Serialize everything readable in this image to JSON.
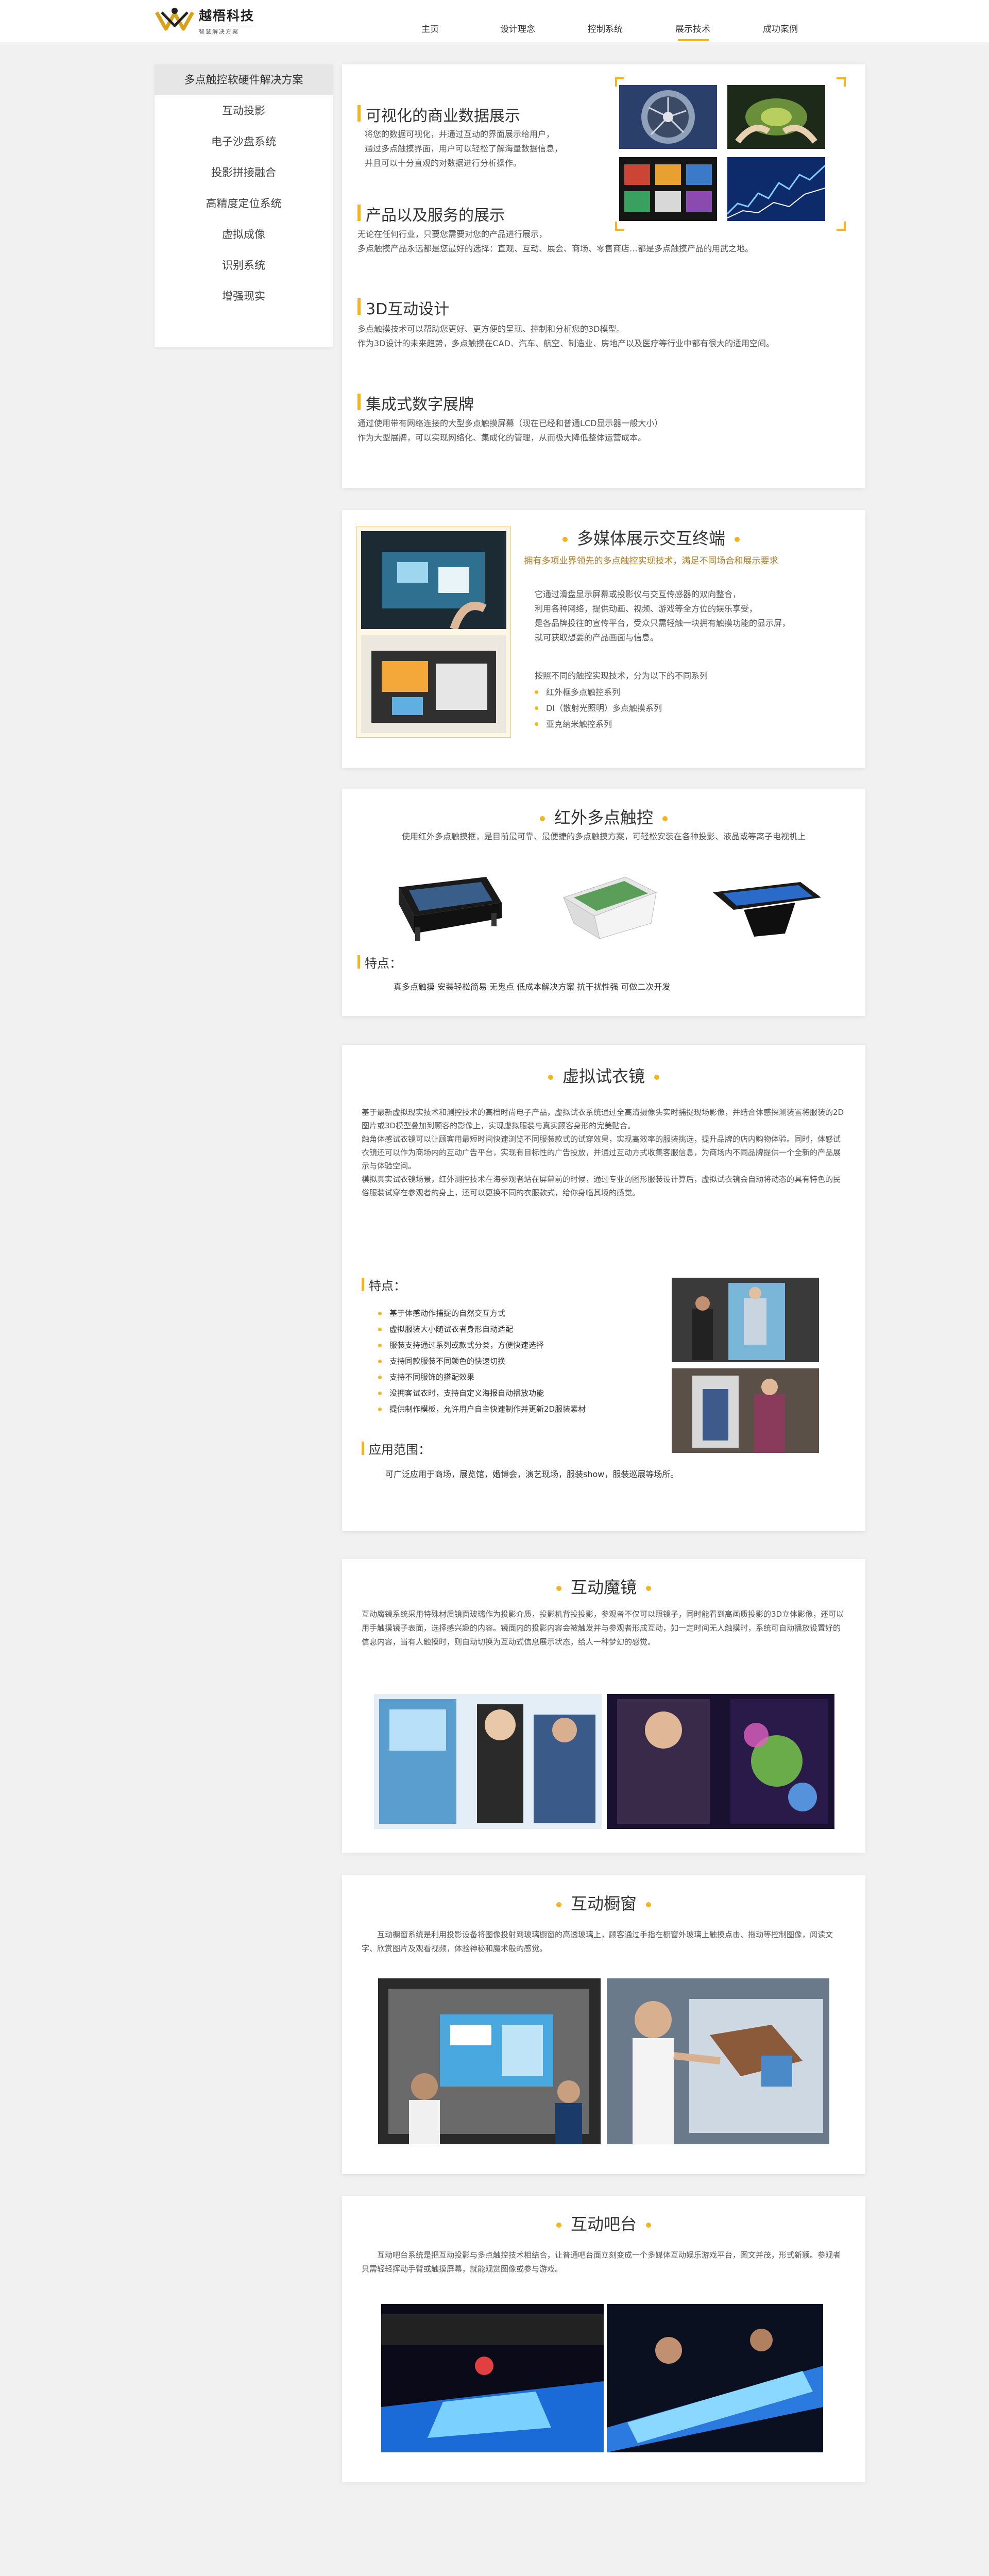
{
  "brand": {
    "name": "越梧科技",
    "tagline": "智慧解决方案"
  },
  "nav": [
    {
      "label": "主页",
      "active": false
    },
    {
      "label": "设计理念",
      "active": false
    },
    {
      "label": "控制系统",
      "active": false
    },
    {
      "label": "展示技术",
      "active": true
    },
    {
      "label": "成功案例",
      "active": false
    }
  ],
  "sidebar": {
    "header": "多点触控软硬件解决方案",
    "items": [
      "互动投影",
      "电子沙盘系统",
      "投影拼接融合",
      "高精度定位系统",
      "虚拟成像",
      "识别系统",
      "增强现实"
    ]
  },
  "intro": {
    "sections": [
      {
        "title": "可视化的商业数据展示",
        "lines": [
          "将您的数据可视化，并通过互动的界面展示给用户，",
          "通过多点触摸界面，用户可以轻松了解海量数据信息，",
          "并且可以十分直观的对数据进行分析操作。"
        ]
      },
      {
        "title": "产品以及服务的展示",
        "lines": [
          "无论在任何行业，只要您需要对您的产品进行展示，",
          "多点触摸产品永远都是您最好的选择：直观、互动、展会、商场、零售商店…都是多点触摸产品的用武之地。"
        ]
      },
      {
        "title": "3D互动设计",
        "lines": [
          "多点触摸技术可以帮助您更好、更方便的呈现、控制和分析您的3D模型。",
          "作为3D设计的未来趋势，多点触摸在CAD、汽车、航空、制造业、房地产以及医疗等行业中都有很大的适用空间。"
        ]
      },
      {
        "title": "集成式数字展牌",
        "lines": [
          "通过使用带有网络连接的大型多点触摸屏幕（现在已经和普通LCD显示器一般大小）",
          "作为大型展牌，可以实现网络化、集成化的管理，从而极大降低整体运营成本。"
        ]
      }
    ]
  },
  "multimedia": {
    "title": "多媒体展示交互终端",
    "subtitle": "拥有多项业界领先的多点触控实现技术，满足不同场合和展示要求",
    "lines": [
      "它通过滑盘显示屏幕或投影仪与交互传感器的双向整合，",
      "利用各种网络，提供动画、视频、游戏等全方位的娱乐享受，",
      "是各品牌投往的宣传平台，受众只需轻触一块拥有触摸功能的显示屏，",
      "就可获取想要的产品画面与信息。"
    ],
    "lead": "按照不同的触控实现技术，分为以下的不同系列",
    "series": [
      "红外框多点触控系列",
      "DI（散射光照明）多点触摸系列",
      "亚克纳米触控系列"
    ]
  },
  "infrared": {
    "title": "红外多点触控",
    "desc": "使用红外多点触摸框，是目前最可靠、最便捷的多点触摸方案，可轻松安装在各种投影、液晶或等离子电视机上",
    "features_label": "特点：",
    "features": "真多点触摸   安装轻松简易  无鬼点  低成本解决方案  抗干扰性强  可做二次开发"
  },
  "fitting": {
    "title": "虚拟试衣镜",
    "paragraphs": [
      "基于最新虚拟现实技术和测控技术的高档时尚电子产品，虚拟试衣系统通过全高清摄像头实时捕捉现场影像，并结合体感探测装置将服装的2D图片或3D模型叠加到顾客的影像上，实现虚拟服装与真实顾客身形的完美贴合。",
      "触角体感试衣镜可以让顾客用最短时间快速浏览不同服装款式的试穿效果，实现高效率的服装挑选，提升品牌的店内购物体验。同时，体感试衣镜还可以作为商场内的互动广告平台，实现有目标性的广告投放，并通过互动方式收集客服信息，为商场内不同品牌提供一个全新的产品展示与体验空间。",
      "模拟真实试衣镜场景，红外测控技术在海参观者站在屏幕前的时候，通过专业的图形服装设计算后，虚拟试衣镜会自动将动态的具有特色的民俗服装试穿在参观者的身上，还可以更换不同的衣服款式，给你身临其境的感觉。"
    ],
    "features_label": "特点：",
    "features": [
      "基于体感动作捕捉的自然交互方式",
      "虚拟服装大小随试衣者身形自动适配",
      "服装支持通过系列或款式分类，方便快速选择",
      "支持同款服装不同颜色的快速切换",
      "支持不同服饰的搭配效果",
      "没拥客试衣时，支持自定义海报自动播放功能",
      "提供制作模板，允许用户自主快速制作并更新2D服装素材"
    ],
    "scope_label": "应用范围：",
    "scope": "可广泛应用于商场，展览馆，婚博会，演艺现场，服装show，服装巡展等场所。"
  },
  "mirror": {
    "title": "互动魔镜",
    "text": "互动魔镜系统采用特殊材质镜面玻璃作为投影介质，投影机背投投影，参观者不仅可以照镜子，同时能看到高画质投影的3D立体影像，还可以用手触摸镜子表面，选择感兴趣的内容。镜面内的投影内容会被触发并与参观者形成互动，如一定时间无人触摸时，系统可自动播放设置好的信息内容，当有人触摸时，则自动切换为互动式信息展示状态，给人一种梦幻的感觉。"
  },
  "window": {
    "title": "互动橱窗",
    "text": "互动橱窗系统是利用投影设备将图像投射到玻璃橱窗的高透玻璃上，顾客通过手指在橱窗外玻璃上触摸点击、拖动等控制图像，阅读文字、欣赏图片及观看视频，体验神秘和魔术般的感觉。"
  },
  "bar": {
    "title": "互动吧台",
    "text": "互动吧台系统是把互动投影与多点触控技术相结合，让普通吧台面立刻变成一个多媒体互动娱乐游戏平台，图文并茂，形式新颖。参观者只需轻轻挥动手臂或触摸屏幕，就能观赏图像或参与游戏。"
  },
  "colors": {
    "accent": "#f5b520",
    "subtitle": "#b07a1e",
    "background": "#f1f1f1"
  }
}
